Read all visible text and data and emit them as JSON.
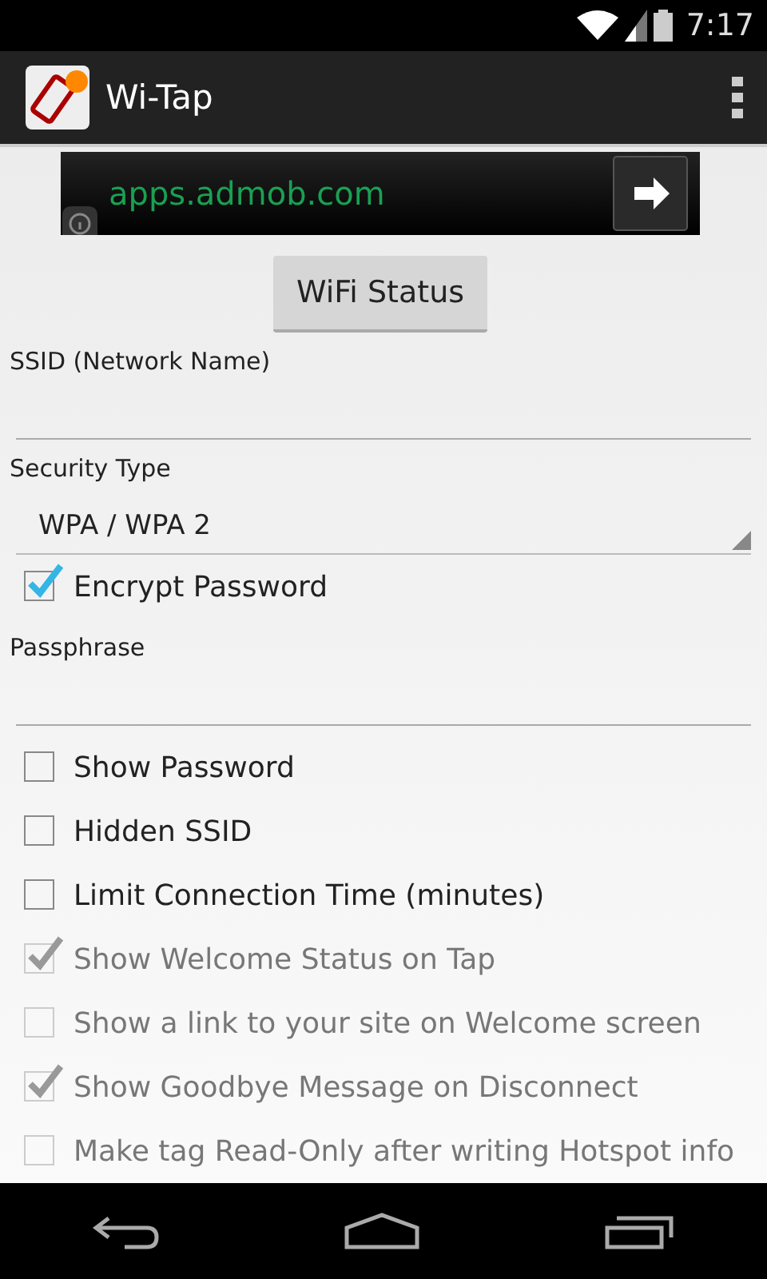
{
  "status_bar": {
    "time": "7:17"
  },
  "action_bar": {
    "title": "Wi-Tap"
  },
  "ad": {
    "text": "apps.admob.com"
  },
  "wifi_status_button": "WiFi Status",
  "ssid": {
    "label": "SSID (Network Name)"
  },
  "security": {
    "label": "Security Type",
    "value": "WPA / WPA 2"
  },
  "encrypt": {
    "label": "Encrypt Password",
    "checked": true,
    "disabled": false
  },
  "passphrase": {
    "label": "Passphrase"
  },
  "options": [
    {
      "label": "Show Password",
      "checked": false,
      "disabled": false
    },
    {
      "label": "Hidden SSID",
      "checked": false,
      "disabled": false
    },
    {
      "label": "Limit Connection Time (minutes)",
      "checked": false,
      "disabled": false
    },
    {
      "label": "Show Welcome Status on Tap",
      "checked": true,
      "disabled": true
    },
    {
      "label": "Show a link to your site on Welcome screen",
      "checked": false,
      "disabled": true
    },
    {
      "label": "Show Goodbye Message on Disconnect",
      "checked": true,
      "disabled": true
    },
    {
      "label": "Make tag Read-Only after writing Hotspot info",
      "checked": false,
      "disabled": true
    }
  ]
}
